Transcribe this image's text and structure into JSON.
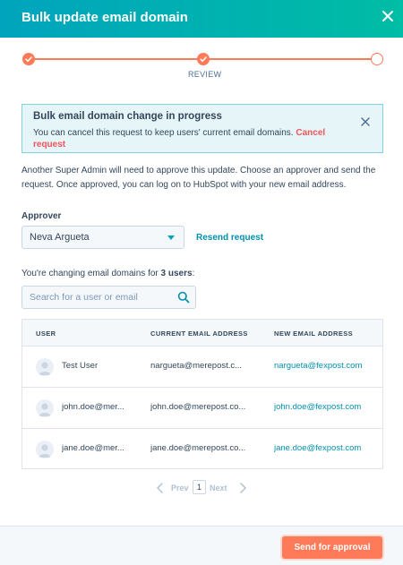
{
  "dialog": {
    "title": "Bulk update email domain"
  },
  "stepper": {
    "current_step_label": "REVIEW",
    "steps_completed": 2,
    "steps_total": 3
  },
  "alert": {
    "title": "Bulk email domain change in progress",
    "text": "You can cancel this request to keep users' current email domains.",
    "link": "Cancel request"
  },
  "description": "Another Super Admin will need to approve this update. Choose an approver and send the request. Once approved, you can log on to HubSpot with your new email address.",
  "approver": {
    "label": "Approver",
    "selected": "Neva Argueta",
    "resend_label": "Resend request"
  },
  "change_summary": {
    "prefix": "You're changing email domains for",
    "count": "3 users",
    "suffix": ":"
  },
  "search": {
    "placeholder": "Search for a user or email",
    "value": ""
  },
  "table": {
    "columns": [
      "USER",
      "CURRENT EMAIL ADDRESS",
      "NEW EMAIL ADDRESS"
    ],
    "rows": [
      {
        "user": "Test User",
        "current": "nargueta@merepost.c...",
        "new": "nargueta@fexpost.com"
      },
      {
        "user": "john.doe@mer...",
        "current": "john.doe@merepost.co...",
        "new": "john.doe@fexpost.com"
      },
      {
        "user": "jane.doe@mer...",
        "current": "jane.doe@merepost.co...",
        "new": "jane.doe@fexpost.com"
      }
    ]
  },
  "pagination": {
    "prev": "Prev",
    "page": "1",
    "next": "Next"
  },
  "footer": {
    "primary_label": "Send for approval"
  },
  "colors": {
    "header_gradient_start": "#00a4bd",
    "header_gradient_end": "#00bda5",
    "accent": "#ff7a59",
    "link": "#0091ae",
    "danger_link": "#f2545b"
  }
}
